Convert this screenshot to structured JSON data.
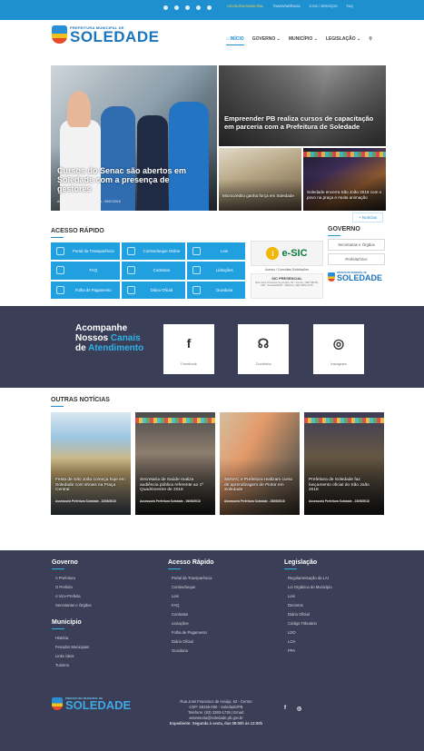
{
  "topbar": {
    "links": [
      "OUVIDORIA MUNICIPAL",
      "TRANSPARÊNCIA",
      "E-SIC / SERVIÇOS",
      "FAQ"
    ]
  },
  "header": {
    "logo_small": "PREFEITURA MUNICIPAL DE",
    "logo_big": "SOLEDADE",
    "nav": [
      "INÍCIO",
      "GOVERNO",
      "MUNICÍPIO",
      "LEGISLAÇÃO"
    ]
  },
  "news": {
    "main": {
      "title": "Cursos do Senac são abertos em Soledade com a presença de gestores",
      "meta": "Assessoria Prefeitura Soledade - 05/07/2018"
    },
    "top_right": {
      "title": "Empreender PB realiza cursos de capacitação em parceria com a Prefeitura de Soledade"
    },
    "small_left": {
      "title": "Microcrédito ganha força em Soledade"
    },
    "small_right": {
      "title": "Soledade encerra São João 2018 com o povo na praça e muita animação"
    },
    "more_label": "+ Notícias"
  },
  "acesso_rapido": {
    "heading": "ACESSO RÁPIDO",
    "items": [
      "Portal da Transparência",
      "Contracheque Online",
      "Leis",
      "FAQ",
      "Contratos",
      "Licitações",
      "Folha de Pagamento",
      "Diário Oficial",
      "Ouvidoria"
    ]
  },
  "esic": {
    "brand": "e-SIC",
    "access": "Acesso / Consultas Solicitações",
    "presencial_title": "SIC PRESENCIAL",
    "presencial_text": "Rua José Francisco de Araújo, 62 - Centro, CEP 58155-000 - Soledade/PB - Telefone: (83) 3383-1725"
  },
  "governo": {
    "heading": "GOVERNO",
    "buttons": [
      "Secretarias e Órgãos",
      "Prefeito/Vice"
    ],
    "logo_small": "PREFEITURA MUNICIPAL DE",
    "logo_big": "SOLEDADE"
  },
  "social": {
    "line1": "Acompanhe",
    "line2": "Nossos",
    "line2_hl": "Canais",
    "line3": "de",
    "line3_hl": "Atendimento",
    "cards": [
      {
        "icon": "facebook-icon",
        "glyph": "f",
        "label": "Facebook"
      },
      {
        "icon": "headset-icon",
        "glyph": "☊",
        "label": "Ouvidoria"
      },
      {
        "icon": "instagram-icon",
        "glyph": "◎",
        "label": "Instagram"
      }
    ]
  },
  "outras": {
    "heading": "OUTRAS NOTÍCIAS",
    "items": [
      {
        "title": "Festa de São João começa hoje em Soledade com shows na Praça Central",
        "meta": "Assessoria Prefeitura Soledade - 22/06/2018"
      },
      {
        "title": "Secretaria de Saúde realiza audiência pública referente ao 1º Quadrimestre de 2018",
        "meta": "Assessoria Prefeitura Soledade - 06/06/2018"
      },
      {
        "title": "SENAC e Prefeitura realizam curso de aprendizagem de Pintor em Soledade",
        "meta": "Assessoria Prefeitura Soledade - 28/05/2018"
      },
      {
        "title": "Prefeitura de Soledade faz lançamento oficial do São João 2018",
        "meta": "Assessoria Prefeitura Soledade - 23/05/2018"
      }
    ]
  },
  "footer": {
    "governo": {
      "heading": "Governo",
      "items": [
        "A Prefeitura",
        "O Prefeito",
        "A Vice-Prefeita",
        "Secretarias e Órgãos"
      ]
    },
    "municipio": {
      "heading": "Município",
      "items": [
        "História",
        "Feriados Municipais",
        "Links Úteis",
        "Turismo"
      ]
    },
    "acesso": {
      "heading": "Acesso Rápido",
      "items": [
        "Portal da Transparência",
        "Contracheque",
        "Leis",
        "FAQ",
        "Contratos",
        "Licitações",
        "Folha de Pagamento",
        "Diário Oficial",
        "Ouvidoria"
      ]
    },
    "legislacao": {
      "heading": "Legislação",
      "items": [
        "Regulamentação da LAI",
        "Lei Orgânica do Município",
        "Leis",
        "Decretos",
        "Diário Oficial",
        "Código Tributário",
        "LDO",
        "LOA",
        "PPA"
      ]
    },
    "logo_small": "PREFEITURA MUNICIPAL DE",
    "logo_big": "SOLEDADE",
    "address": [
      "Rua José Francisco de Araújo, 62 - Centro",
      "CEP: 58155-000 - Soledade/PB",
      "Telefone: (83) 3383-1725 | Email:",
      "assessoria@soledade.pb.gov.br",
      "Expediente: Segunda à sexta, das 08:00h às 13:00h"
    ],
    "social": [
      {
        "icon": "facebook-icon",
        "glyph": "f"
      },
      {
        "icon": "instagram-icon",
        "glyph": "◎"
      }
    ]
  }
}
